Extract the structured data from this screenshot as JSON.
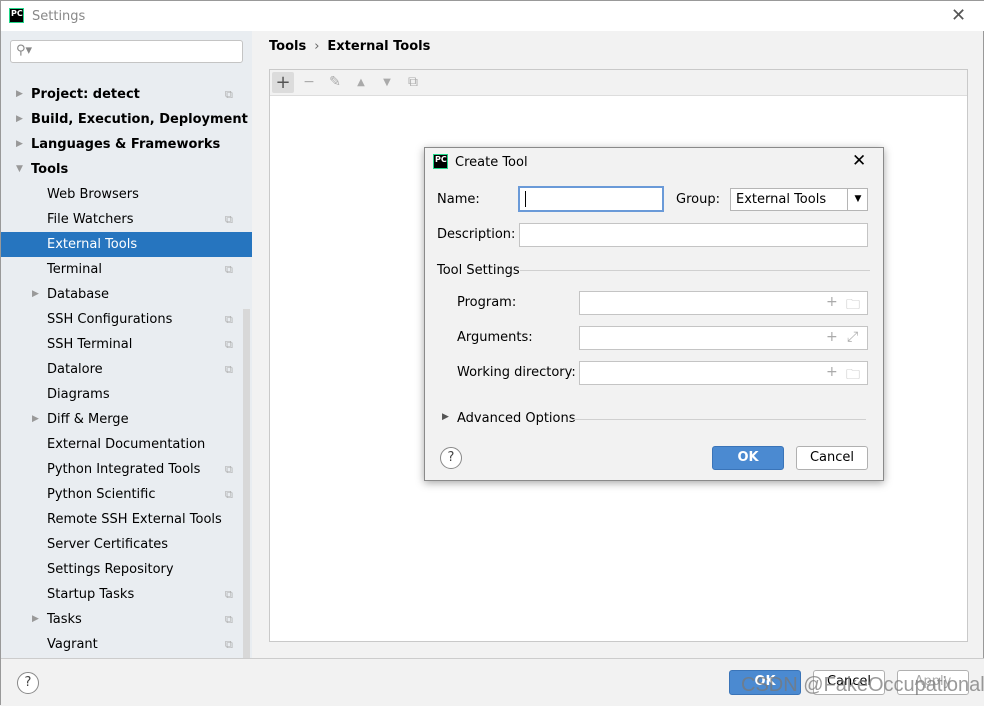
{
  "window": {
    "title": "Settings",
    "logo": "PC"
  },
  "search": {
    "placeholder": ""
  },
  "tree": [
    {
      "label": "Project: detect",
      "level": 0,
      "bold": true,
      "arrow": true,
      "copy": true
    },
    {
      "label": "Build, Execution, Deployment",
      "level": 0,
      "bold": true,
      "arrow": true
    },
    {
      "label": "Languages & Frameworks",
      "level": 0,
      "bold": true,
      "arrow": true
    },
    {
      "label": "Tools",
      "level": 0,
      "bold": true,
      "arrow": true,
      "expanded": true
    },
    {
      "label": "Web Browsers",
      "level": 1
    },
    {
      "label": "File Watchers",
      "level": 1,
      "copy": true
    },
    {
      "label": "External Tools",
      "level": 1,
      "selected": true
    },
    {
      "label": "Terminal",
      "level": 1,
      "copy": true
    },
    {
      "label": "Database",
      "level": 1,
      "arrow": true
    },
    {
      "label": "SSH Configurations",
      "level": 1,
      "copy": true
    },
    {
      "label": "SSH Terminal",
      "level": 1,
      "copy": true
    },
    {
      "label": "Datalore",
      "level": 1,
      "copy": true
    },
    {
      "label": "Diagrams",
      "level": 1
    },
    {
      "label": "Diff & Merge",
      "level": 1,
      "arrow": true
    },
    {
      "label": "External Documentation",
      "level": 1
    },
    {
      "label": "Python Integrated Tools",
      "level": 1,
      "copy": true
    },
    {
      "label": "Python Scientific",
      "level": 1,
      "copy": true
    },
    {
      "label": "Remote SSH External Tools",
      "level": 1
    },
    {
      "label": "Server Certificates",
      "level": 1
    },
    {
      "label": "Settings Repository",
      "level": 1
    },
    {
      "label": "Startup Tasks",
      "level": 1,
      "copy": true
    },
    {
      "label": "Tasks",
      "level": 1,
      "arrow": true,
      "copy": true
    },
    {
      "label": "Vagrant",
      "level": 1,
      "copy": true
    }
  ],
  "breadcrumb": {
    "parent": "Tools",
    "separator": "›",
    "current": "External Tools"
  },
  "dialog": {
    "title": "Create Tool",
    "name_label": "Name:",
    "name_value": "",
    "group_label": "Group:",
    "group_value": "External Tools",
    "description_label": "Description:",
    "description_value": "",
    "tool_settings": "Tool Settings",
    "program_label": "Program:",
    "program_value": "",
    "arguments_label": "Arguments:",
    "arguments_value": "",
    "workdir_label": "Working directory:",
    "workdir_value": "",
    "advanced": "Advanced Options",
    "ok": "OK",
    "cancel": "Cancel",
    "help": "?"
  },
  "footer": {
    "ok": "OK",
    "cancel": "Cancel",
    "apply": "Apply",
    "help": "?"
  },
  "watermark": "CSDN @FakeOccupational",
  "colors": {
    "selection": "#2675bf",
    "primary_button": "#4b8ad1"
  }
}
